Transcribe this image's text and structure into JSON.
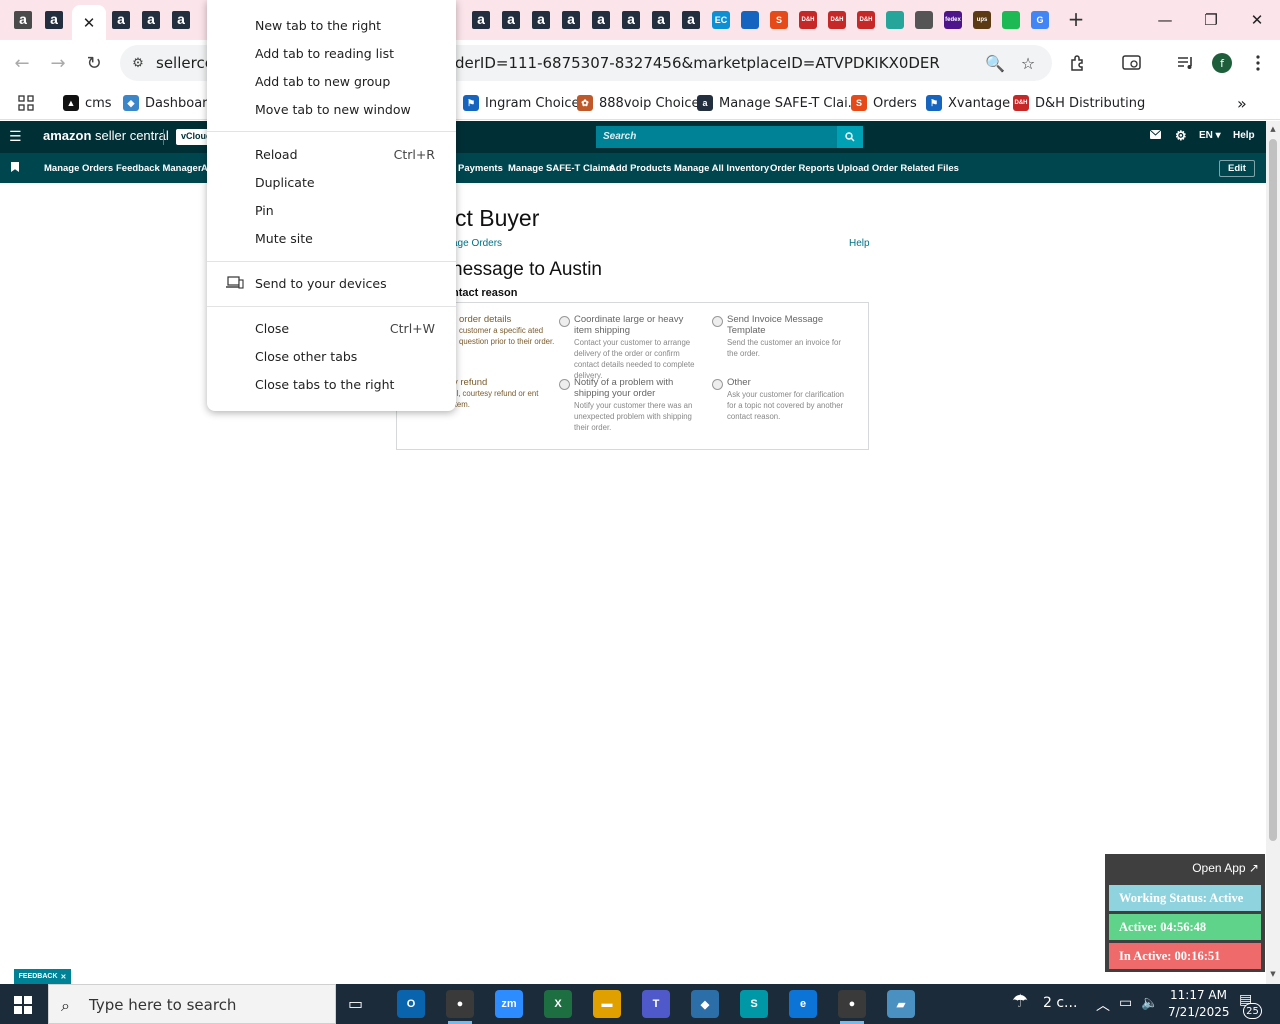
{
  "tab_strip": {
    "favicon_letter": "a",
    "active_tab_close": "✕",
    "new_tab": "+",
    "window_controls": {
      "minimize": "—",
      "restore": "❐",
      "close": "✕"
    },
    "extra_favicons": [
      {
        "label": "EC",
        "color": "#0d8fd3"
      },
      {
        "label": "",
        "color": "#1565c0"
      },
      {
        "label": "S",
        "color": "#e64a19"
      },
      {
        "label": "D&H",
        "color": "#c62828"
      },
      {
        "label": "D&H",
        "color": "#c62828"
      },
      {
        "label": "D&H",
        "color": "#c62828"
      },
      {
        "label": "",
        "color": "#26a69a"
      },
      {
        "label": "",
        "color": "#555555"
      },
      {
        "label": "fedex",
        "color": "#4d148c"
      },
      {
        "label": "ups",
        "color": "#5b3a14"
      },
      {
        "label": "",
        "color": "#1db954"
      },
      {
        "label": "G",
        "color": "#4285f4"
      }
    ]
  },
  "toolbar": {
    "back": "←",
    "forward": "→",
    "reload": "↻",
    "site_info": "⚙",
    "url_visible_start": "sellercen",
    "url_visible_end": "derID=111-6875307-8327456&marketplaceID=ATVPDKIKX0DER",
    "zoom_icon": "🔍",
    "star_icon": "☆",
    "profile_letter": "f"
  },
  "bookmarks": [
    {
      "label": "cms",
      "color": "#111111",
      "glyph": "▲"
    },
    {
      "label": "Dashboard",
      "color": "#3a86c8",
      "glyph": "◆"
    },
    {
      "label": "Ingram Choice",
      "color": "#1565c0",
      "glyph": "⚑"
    },
    {
      "label": "888voip Choice",
      "color": "#c0592a",
      "glyph": "✿"
    },
    {
      "label": "Manage SAFE-T Clai...",
      "color": "#232f3e",
      "glyph": "a"
    },
    {
      "label": "Orders",
      "color": "#e64a19",
      "glyph": "S"
    },
    {
      "label": "Xvantage",
      "color": "#1565c0",
      "glyph": "⚑"
    },
    {
      "label": "D&H Distributing",
      "color": "#c62828",
      "glyph": "D&H"
    }
  ],
  "bookmarks_overflow": "»",
  "seller_central": {
    "logo_bold": "amazon",
    "logo_rest": " seller central",
    "account_badge": "vCloud",
    "search_placeholder": "Search",
    "language": "EN ▾",
    "help": "Help",
    "nav_links": [
      "Manage Orders",
      "Feedback Manager",
      "A",
      "Payments",
      "Manage SAFE-T Claims",
      "Add Products",
      "Manage All Inventory",
      "Order Reports",
      "Upload Order Related Files"
    ],
    "edit": "Edit"
  },
  "page": {
    "heading": "ct Buyer",
    "breadcrumb": "age Orders",
    "help": "Help",
    "subheading": "nessage to Austin",
    "reason_label": "ntact reason",
    "options": [
      {
        "title": "order details",
        "desc": "customer a specific ated question prior to their order."
      },
      {
        "title": "Coordinate large or heavy item shipping",
        "desc": "Contact your customer to arrange delivery of the order or confirm contact details needed to complete delivery."
      },
      {
        "title": "Send Invoice Message Template",
        "desc": "Send the customer an invoice for the order."
      },
      {
        "title": "y refund",
        "desc": "ill, courtesy refund or ent item."
      },
      {
        "title": "Notify of a problem with shipping your order",
        "desc": "Notify your customer there was an unexpected problem with shipping their order."
      },
      {
        "title": "Other",
        "desc": "Ask your customer for clarification for a topic not covered by another contact reason."
      }
    ]
  },
  "context_menu": {
    "items": [
      {
        "label": "New tab to the right",
        "shortcut": ""
      },
      {
        "label": "Add tab to reading list",
        "shortcut": ""
      },
      {
        "label": "Add tab to new group",
        "shortcut": ""
      },
      {
        "label": "Move tab to new window",
        "shortcut": ""
      },
      {
        "label": "Reload",
        "shortcut": "Ctrl+R"
      },
      {
        "label": "Duplicate",
        "shortcut": ""
      },
      {
        "label": "Pin",
        "shortcut": ""
      },
      {
        "label": "Mute site",
        "shortcut": ""
      },
      {
        "label": "Send to your devices",
        "shortcut": ""
      },
      {
        "label": "Close",
        "shortcut": "Ctrl+W"
      },
      {
        "label": "Close other tabs",
        "shortcut": ""
      },
      {
        "label": "Close tabs to the right",
        "shortcut": ""
      }
    ]
  },
  "tracker": {
    "open_app": "Open App ↗",
    "working_status": "Working Status: Active",
    "active": "Active: 04:56:48",
    "inactive": "In Active: 00:16:51",
    "colors": {
      "status": "#8fd3de",
      "active": "#5fd38a",
      "inactive": "#ef6b6b"
    }
  },
  "feedback": {
    "label": "FEEDBACK",
    "close": "✕"
  },
  "taskbar": {
    "search_placeholder": "Type here to search",
    "apps": [
      {
        "label": "O",
        "color": "#0a64ad"
      },
      {
        "label": "●",
        "color": "#3a3a3a"
      },
      {
        "label": "zm",
        "color": "#2d8cff"
      },
      {
        "label": "X",
        "color": "#1d6f42"
      },
      {
        "label": "▬",
        "color": "#e0a100"
      },
      {
        "label": "T",
        "color": "#5059c9"
      },
      {
        "label": "◆",
        "color": "#2b6ea8"
      },
      {
        "label": "S",
        "color": "#0097a7"
      },
      {
        "label": "e",
        "color": "#0c74d6"
      },
      {
        "label": "●",
        "color": "#3a3a3a"
      },
      {
        "label": "▰",
        "color": "#4a90c0"
      }
    ],
    "weather": "2 c...",
    "time": "11:17 AM",
    "date": "7/21/2025",
    "notifications": "25"
  }
}
